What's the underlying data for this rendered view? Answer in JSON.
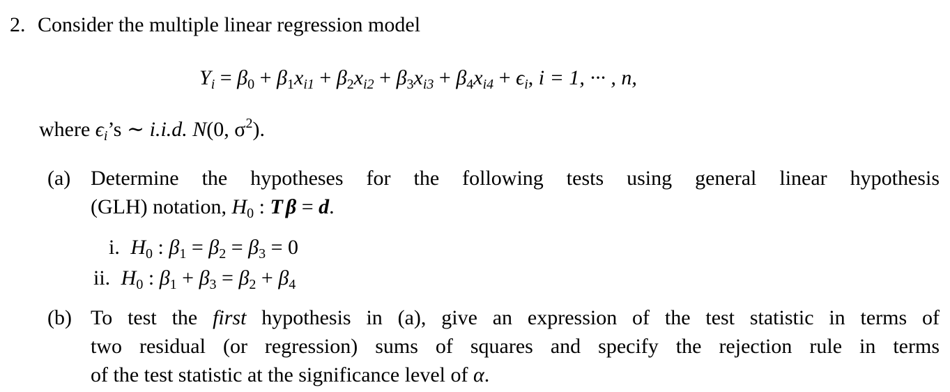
{
  "problem": {
    "number": "2.",
    "intro": "Consider the multiple linear regression model",
    "equation": {
      "lhs": "Y",
      "lhs_sub": "i",
      "terms": [
        {
          "coef": "β",
          "coef_sub": "0",
          "var": "",
          "var_sub": ""
        },
        {
          "coef": "β",
          "coef_sub": "1",
          "var": "x",
          "var_sub": "i1"
        },
        {
          "coef": "β",
          "coef_sub": "2",
          "var": "x",
          "var_sub": "i2"
        },
        {
          "coef": "β",
          "coef_sub": "3",
          "var": "x",
          "var_sub": "i3"
        },
        {
          "coef": "β",
          "coef_sub": "4",
          "var": "x",
          "var_sub": "i4"
        }
      ],
      "error": "ϵ",
      "error_sub": "i",
      "index_range": "i = 1, ··· , n,"
    },
    "where_text": "where",
    "where_eps": "ϵ",
    "where_eps_sub": "i",
    "where_rest": "’s ∼",
    "where_iid": "i.i.d.",
    "where_dist": "N",
    "where_dist_args": "(0, σ",
    "where_dist_sup": "2",
    "where_dist_end": ")."
  },
  "parts": {
    "a": {
      "label": "(a)",
      "line1": "Determine the hypotheses for the following tests using general linear hypothesis",
      "line2_text": "(GLH) notation,",
      "line2_H": "H",
      "line2_H_sub": "0",
      "line2_colon": " : ",
      "line2_T": "T",
      "line2_beta": "β",
      "line2_eq": " = ",
      "line2_d": "d",
      "line2_end": ".",
      "items": [
        {
          "label": "i.",
          "H": "H",
          "H_sub": "0",
          "expr_html_parts": [
            "β",
            "1",
            " = ",
            "β",
            "2",
            " = ",
            "β",
            "3",
            " = 0"
          ]
        },
        {
          "label": "ii.",
          "H": "H",
          "H_sub": "0",
          "expr_html_parts": [
            "β",
            "1",
            " + ",
            "β",
            "3",
            " = ",
            "β",
            "2",
            " + ",
            "β",
            "4",
            ""
          ]
        }
      ]
    },
    "b": {
      "label": "(b)",
      "line1_pre": "To test the",
      "line1_em": "first",
      "line1_post": "hypothesis in (a), give an expression of the test statistic in terms of",
      "line2": "two residual (or regression) sums of squares and specify the rejection rule in terms",
      "line3_pre": "of the test statistic at the significance level of",
      "line3_alpha": "α",
      "line3_end": "."
    }
  }
}
